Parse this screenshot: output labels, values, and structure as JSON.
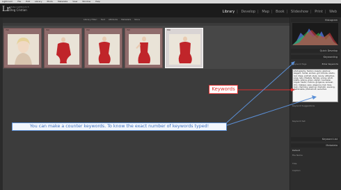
{
  "menubar": {
    "items": [
      "Lightroom",
      "File",
      "Edit",
      "Library",
      "Photo",
      "Metadata",
      "View",
      "Window",
      "Help"
    ]
  },
  "identity": {
    "logo": "Lr",
    "line1": "Adobe Lightroom 5",
    "line2": "Oleg Cristian"
  },
  "modules": [
    "Library",
    "Develop",
    "Map",
    "Book",
    "Slideshow",
    "Print",
    "Web"
  ],
  "active_module": "Library",
  "filter": {
    "label": "Library Filter:",
    "options": [
      "Text",
      "Attribute",
      "Metadata",
      "None"
    ]
  },
  "thumbnails": [
    {
      "label": "PSD"
    },
    {
      "label": "PSD"
    },
    {
      "label": "PSD"
    },
    {
      "label": "PSD"
    },
    {
      "label": "PSD"
    }
  ],
  "right_panel": {
    "histogram_title": "Histogram",
    "quick_develop": "Quick Develop",
    "keywording": "Keywording",
    "keyword_tags_label": "Keyword Tags",
    "keyword_tags_mode": "Enter Keywords",
    "keywords_text": "photography, fashion, beauty, glamour, elegant, model, woman, girl, blonde, studio, red, dress, portrait, style, luxury, attractive, pose, lady, lifestyle, female, young, adult, pretty, posing, gown, stylish, caucasian, vogue, haute, couture, gorgeous, sensual, chic, makeup, sexy, elegance, hair, face, look, charming, wearing, dramatic, evening, fashionable, photoshoot, seductive",
    "keyword_suggestions": "Keyword Suggestions",
    "keyword_set": "Keyword Set",
    "keyword_list": "Keyword List",
    "metadata": "Metadata",
    "preset_label": "Default",
    "file_name_label": "File Name",
    "title_label": "Title",
    "caption_label": "Caption"
  },
  "annotations": {
    "keywords": "Keywords",
    "counter": "You can make a counter keywords. To know the exact number of keywords typed!"
  },
  "colors": {
    "annotation_red": "#e03030",
    "annotation_blue": "#3c6fc0",
    "thumb_bg": "#8f6c6c",
    "dress_red": "#c0252a"
  }
}
